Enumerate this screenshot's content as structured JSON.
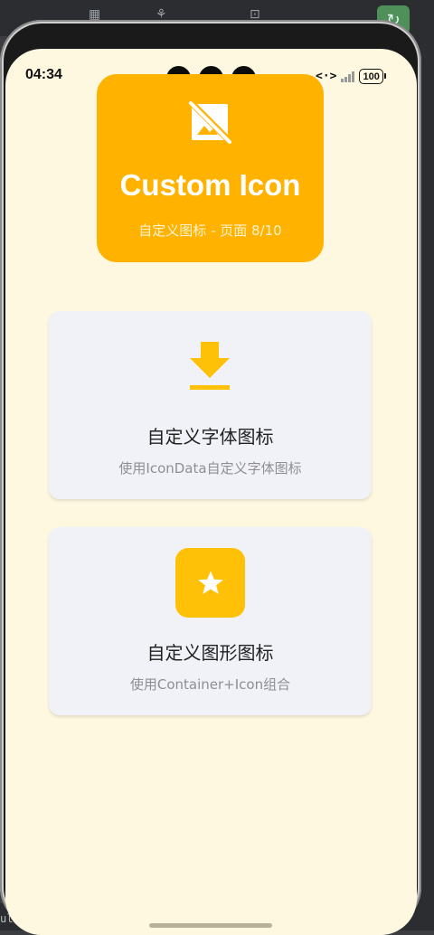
{
  "status_bar": {
    "time": "04:34",
    "data_icon": "<·>",
    "battery": "100"
  },
  "header": {
    "title": "Custom Icon",
    "subtitle": "自定义图标 - 页面 8/10",
    "icon": "image-not-supported-icon"
  },
  "cards": [
    {
      "title": "自定义字体图标",
      "description": "使用IconData自定义字体图标",
      "icon": "download-icon"
    },
    {
      "title": "自定义图形图标",
      "description": "使用Container+Icon组合",
      "icon": "star-icon"
    }
  ],
  "ide": {
    "side_text": "ule"
  },
  "colors": {
    "accent": "#ffb300",
    "star_badge": "#ffc107",
    "page_background": "#fff8e1",
    "card_background": "#f1f2f8"
  }
}
